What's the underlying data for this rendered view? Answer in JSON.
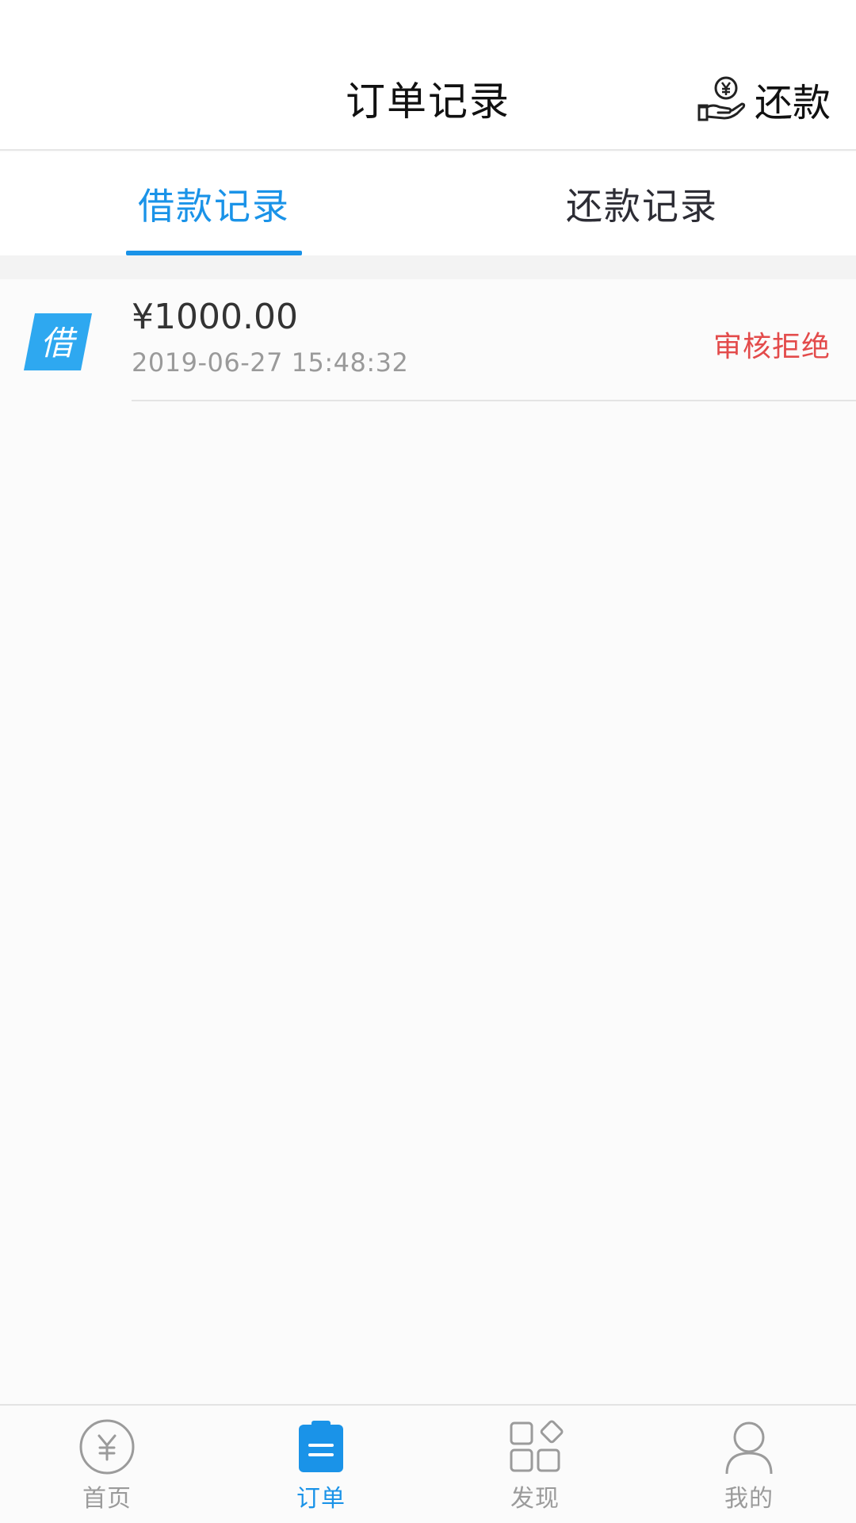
{
  "header": {
    "title": "订单记录",
    "repay_label": "还款",
    "repay_icon": "hand-yen-icon"
  },
  "tabs": [
    {
      "label": "借款记录",
      "active": true
    },
    {
      "label": "还款记录",
      "active": false
    }
  ],
  "records": [
    {
      "badge_text": "借",
      "badge_color": "#2ea8f0",
      "amount": "¥1000.00",
      "date": "2019-06-27 15:48:32",
      "status": "审核拒绝",
      "status_color": "#e34b4b"
    }
  ],
  "bottom_nav": [
    {
      "label": "首页",
      "icon": "yen-circle-icon",
      "active": false
    },
    {
      "label": "订单",
      "icon": "clipboard-icon",
      "active": true
    },
    {
      "label": "发现",
      "icon": "grid-icon",
      "active": false
    },
    {
      "label": "我的",
      "icon": "person-icon",
      "active": false
    }
  ],
  "colors": {
    "accent": "#1a93e8",
    "nav_inactive": "#9b9b9b"
  }
}
